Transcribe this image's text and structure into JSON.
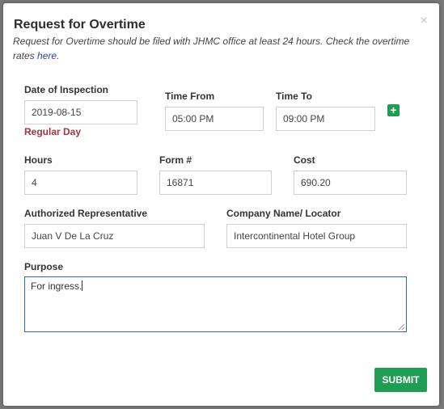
{
  "modal": {
    "title": "Request for Overtime",
    "close_symbol": "×",
    "subtitle": "Request for Overtime should be filed with JHMC office at least 24 hours. Check the overtime rates",
    "subtitle_link": "here",
    "subtitle_end": "."
  },
  "fields": {
    "date_of_inspection": {
      "label": "Date of Inspection",
      "value": "2019-08-15"
    },
    "day_type": "Regular Day",
    "time_from": {
      "label": "Time From",
      "value": "05:00 PM"
    },
    "time_to": {
      "label": "Time To",
      "value": "09:00 PM"
    },
    "add_icon": "plus-icon",
    "add_symbol": "+",
    "hours": {
      "label": "Hours",
      "value": "4"
    },
    "form_no": {
      "label": "Form #",
      "value": "16871"
    },
    "cost": {
      "label": "Cost",
      "value": "690.20"
    },
    "authorized_rep": {
      "label": "Authorized Representative",
      "value": "Juan V De La Cruz"
    },
    "company_name": {
      "label": "Company Name/ Locator",
      "value": "Intercontinental Hotel Group"
    },
    "purpose": {
      "label": "Purpose",
      "value": "For ingress."
    }
  },
  "actions": {
    "submit_label": "SUBMIT"
  },
  "colors": {
    "accent_green": "#1f9d55",
    "day_type_red": "#a3363b",
    "link_blue": "#2a3fbf"
  }
}
